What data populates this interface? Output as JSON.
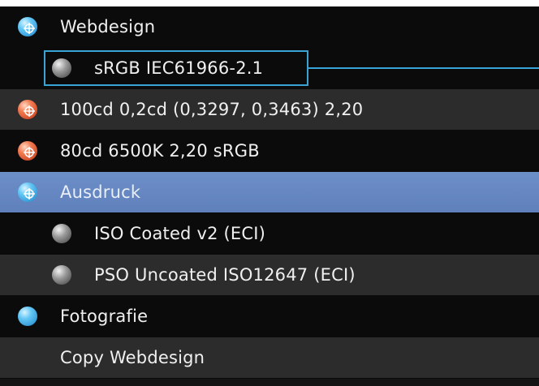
{
  "profiles": {
    "items": [
      {
        "label": "Webdesign",
        "icon": "blue-target-icon",
        "level": 0
      },
      {
        "label": "sRGB IEC61966-2.1",
        "icon": "gray-sphere-icon",
        "level": 1,
        "focused": true
      },
      {
        "label": "100cd 0,2cd  (0,3297, 0,3463) 2,20",
        "icon": "red-target-icon",
        "level": 0
      },
      {
        "label": "80cd 6500K 2,20 sRGB",
        "icon": "red-target-icon",
        "level": 0
      },
      {
        "label": "Ausdruck",
        "icon": "blue-target-icon",
        "level": 0,
        "selected": true
      },
      {
        "label": "ISO Coated v2 (ECI)",
        "icon": "gray-sphere-icon",
        "level": 1
      },
      {
        "label": "PSO Uncoated ISO12647 (ECI)",
        "icon": "gray-sphere-icon",
        "level": 1
      },
      {
        "label": "Fotografie",
        "icon": "blue-sphere-icon",
        "level": 0
      },
      {
        "label": "Copy Webdesign",
        "icon": "none",
        "level": 0
      }
    ]
  },
  "colors": {
    "selection": "#5f80bb",
    "focus_outline": "#3aa3d6",
    "row_dark": "#0b0b0b",
    "row_mid": "#2c2c2c"
  }
}
